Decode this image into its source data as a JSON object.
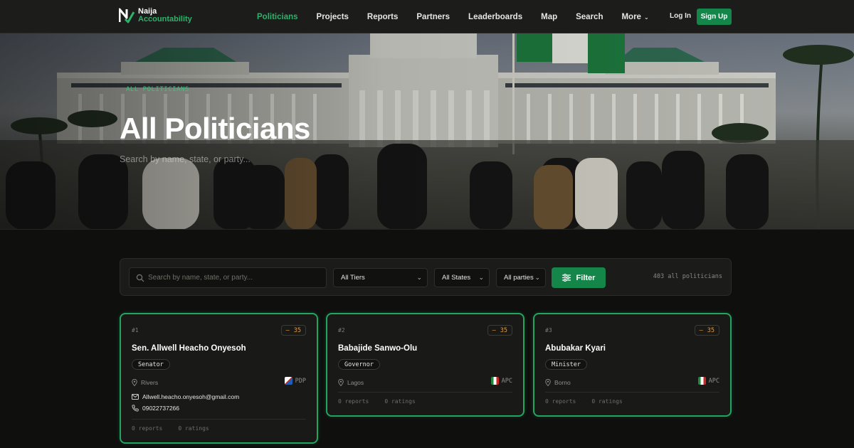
{
  "brand": {
    "line1": "Naija",
    "line2": "Accountability"
  },
  "nav": {
    "items": [
      "Politicians",
      "Projects",
      "Reports",
      "Partners",
      "Leaderboards",
      "Map",
      "Search",
      "More"
    ],
    "login": "Log In",
    "signup": "Sign Up"
  },
  "hero": {
    "kicker": "ALL POLITICIANS",
    "title": "All Politicians",
    "subtitle": "Search by name, state, or party..."
  },
  "filters": {
    "search_placeholder": "Search by name, state, or party...",
    "tier": "All Tiers",
    "state": "All States",
    "party": "All parties",
    "filter_label": "Filter",
    "count": "403 all politicians"
  },
  "cards": [
    {
      "rank": "#1",
      "score": "35",
      "name": "Sen. Allwell Heacho Onyesoh",
      "role": "Senator",
      "location": "Rivers",
      "party": "PDP",
      "email": "Allwell.heacho.onyesoh@gmail.com",
      "phone": "09022737266",
      "reports": "0 reports",
      "ratings": "0 ratings"
    },
    {
      "rank": "#2",
      "score": "35",
      "name": "Babajide Sanwo-Olu",
      "role": "Governor",
      "location": "Lagos",
      "party": "APC",
      "reports": "0 reports",
      "ratings": "0 ratings"
    },
    {
      "rank": "#3",
      "score": "35",
      "name": "Abubakar Kyari",
      "role": "Minister",
      "location": "Borno",
      "party": "APC",
      "reports": "0 reports",
      "ratings": "0 ratings"
    }
  ],
  "colors": {
    "accent": "#15864a",
    "accent_text": "#2bb36a",
    "score": "#e59a38",
    "card_border": "#22a55e"
  },
  "icons": [
    "logo-mark-icon",
    "chevron-down-icon",
    "search-icon",
    "sliders-icon",
    "location-pin-icon",
    "mail-icon",
    "phone-icon",
    "party-flag-icon"
  ]
}
